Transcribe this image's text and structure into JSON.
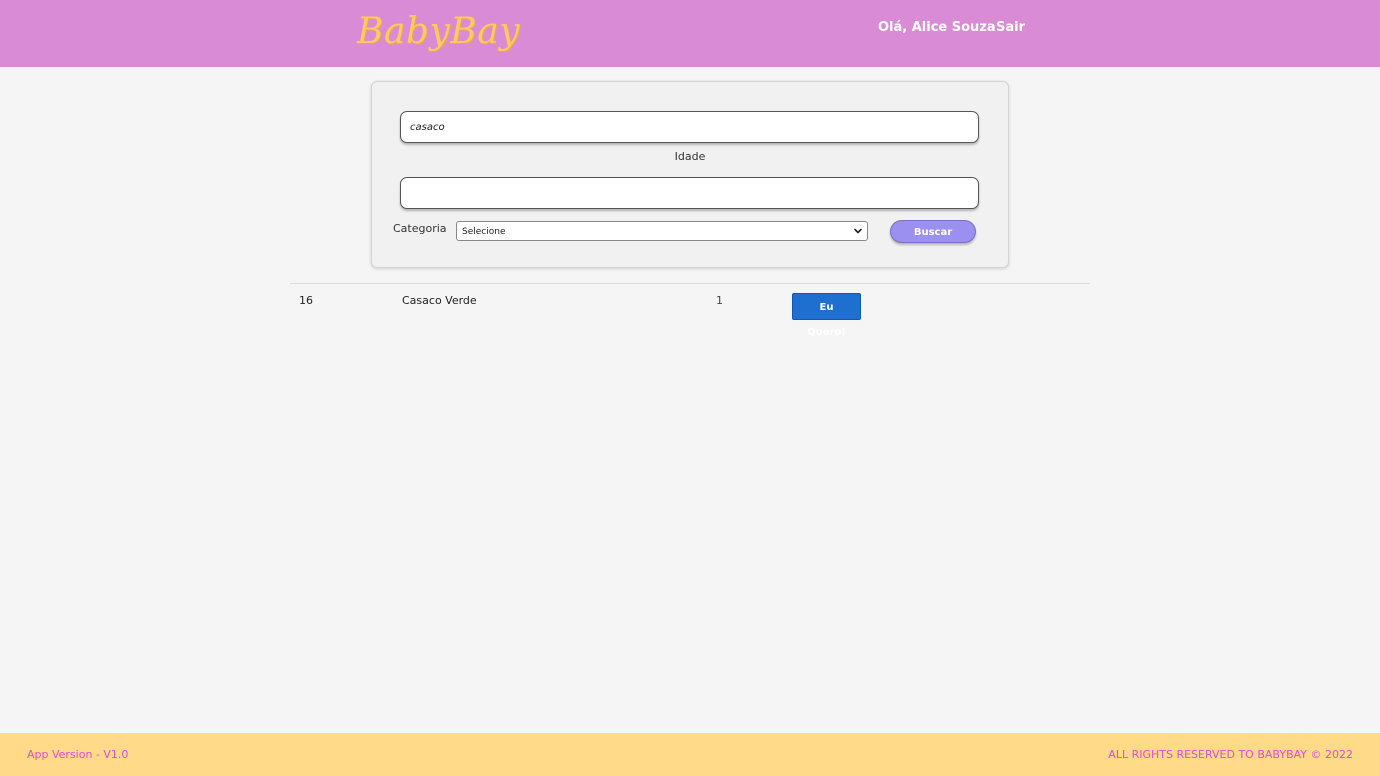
{
  "header": {
    "logo_text": "BabyBay",
    "greeting": "Olá, Alice Souza",
    "logout_label": "Sair",
    "background_color": "#da8bd6",
    "logo_color": "#ffc766"
  },
  "search": {
    "name_value": "casaco",
    "age_label": "Idade",
    "age_value": "",
    "category_label": "Categoria",
    "category_selected": "Selecione",
    "search_button_label": "Buscar",
    "search_button_color": "#9b8ff0"
  },
  "results": {
    "rows": [
      {
        "id": "16",
        "name": "Casaco Verde",
        "quantity": "1",
        "action_label": "Eu Quero!"
      }
    ],
    "action_button_color": "#1f6fd0"
  },
  "footer": {
    "version": "App Version - V1.0",
    "rights": "ALL RIGHTS RESERVED TO BABYBAY © 2022",
    "background_color": "#ffda88",
    "text_color": "#e04cd8"
  }
}
